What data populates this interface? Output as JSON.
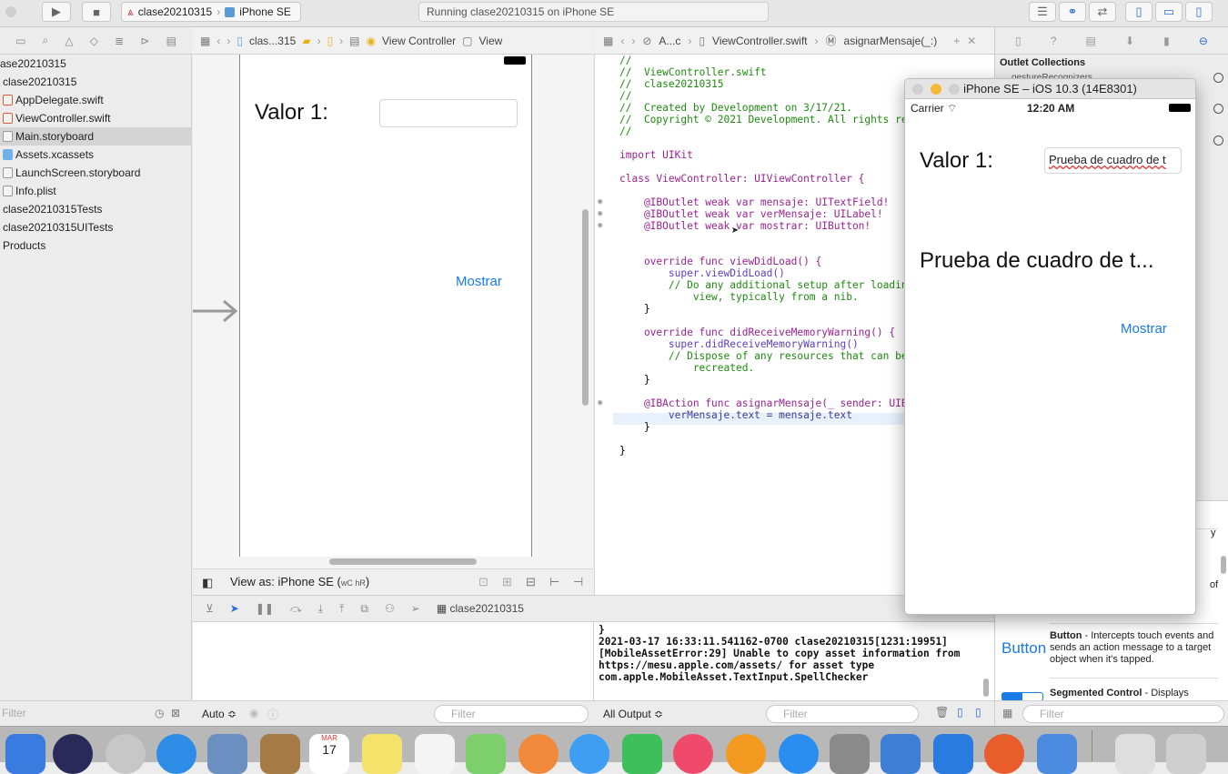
{
  "toolbar": {
    "scheme_name": "clase20210315",
    "device": "iPhone SE",
    "status": "Running clase20210315 on iPhone SE"
  },
  "navigator": {
    "items": [
      {
        "label": "ase20210315"
      },
      {
        "label": "clase20210315"
      },
      {
        "label": "AppDelegate.swift"
      },
      {
        "label": "ViewController.swift"
      },
      {
        "label": "Main.storyboard"
      },
      {
        "label": "Assets.xcassets"
      },
      {
        "label": "LaunchScreen.storyboard"
      },
      {
        "label": "Info.plist"
      },
      {
        "label": "clase20210315Tests"
      },
      {
        "label": "clase20210315UITests"
      },
      {
        "label": "Products"
      }
    ],
    "filter_placeholder": "Filter"
  },
  "storyboard": {
    "jumpbar": [
      "clas...315",
      "View Controller",
      "View"
    ],
    "label_valor": "Valor 1:",
    "button_mostrar": "Mostrar",
    "view_as": "View as: iPhone SE (",
    "view_as_w": "wC hR",
    "view_as_close": ")"
  },
  "code_editor": {
    "jumpbar": [
      "A...c",
      "ViewController.swift",
      "asignarMensaje(_:)"
    ],
    "lines": [
      "//",
      "//  ViewController.swift",
      "//  clase20210315",
      "//",
      "//  Created by Development on 3/17/21.",
      "//  Copyright © 2021 Development. All rights re",
      "//",
      "",
      "import UIKit",
      "",
      "class ViewController: UIViewController {",
      "",
      "    @IBOutlet weak var mensaje: UITextField!",
      "    @IBOutlet weak var verMensaje: UILabel!",
      "    @IBOutlet weak var mostrar: UIButton!",
      "",
      "",
      "    override func viewDidLoad() {",
      "        super.viewDidLoad()",
      "        // Do any additional setup after loadin",
      "            view, typically from a nib.",
      "    }",
      "",
      "    override func didReceiveMemoryWarning() {",
      "        super.didReceiveMemoryWarning()",
      "        // Dispose of any resources that can be",
      "            recreated.",
      "    }",
      "",
      "    @IBAction func asignarMensaje(_ sender: UIB",
      "        verMensaje.text = mensaje.text",
      "    }",
      "",
      "}"
    ]
  },
  "debug": {
    "target": "clase20210315",
    "auto_label": "Auto ≎",
    "filter_placeholder": "Filter",
    "output_label": "All Output ≎",
    "console": "}\n2021-03-17 16:33:11.541162-0700 clase20210315[1231:19951]\n[MobileAssetError:29] Unable to copy asset information from\nhttps://mesu.apple.com/assets/ for asset type\ncom.apple.MobileAsset.TextInput.SpellChecker"
  },
  "inspector": {
    "section": "Outlet Collections",
    "item": "gestureRecognizers",
    "library": {
      "item1_tail": "y",
      "item2_tail": "of",
      "button_preview": "Button",
      "button_title": "Button",
      "button_desc": " - Intercepts touch events and sends an action message to a target object when it's tapped.",
      "seg_title": "Segmented Control",
      "seg_desc": " - Displays"
    },
    "filter_placeholder": "Filter"
  },
  "simulator": {
    "title": "iPhone SE – iOS 10.3 (14E8301)",
    "carrier": "Carrier",
    "time": "12:20 AM",
    "label_valor": "Valor 1:",
    "textfield_value": "Prueba de cuadro de t",
    "message": "Prueba de cuadro de t...",
    "button_mostrar": "Mostrar"
  },
  "dock": {
    "calendar_month": "MAR",
    "calendar_day": "17"
  },
  "colors": {
    "accent_blue": "#1a7ae6",
    "selection": "#d4d4d4",
    "comment": "#1f8a10",
    "keyword": "#9b2393"
  }
}
